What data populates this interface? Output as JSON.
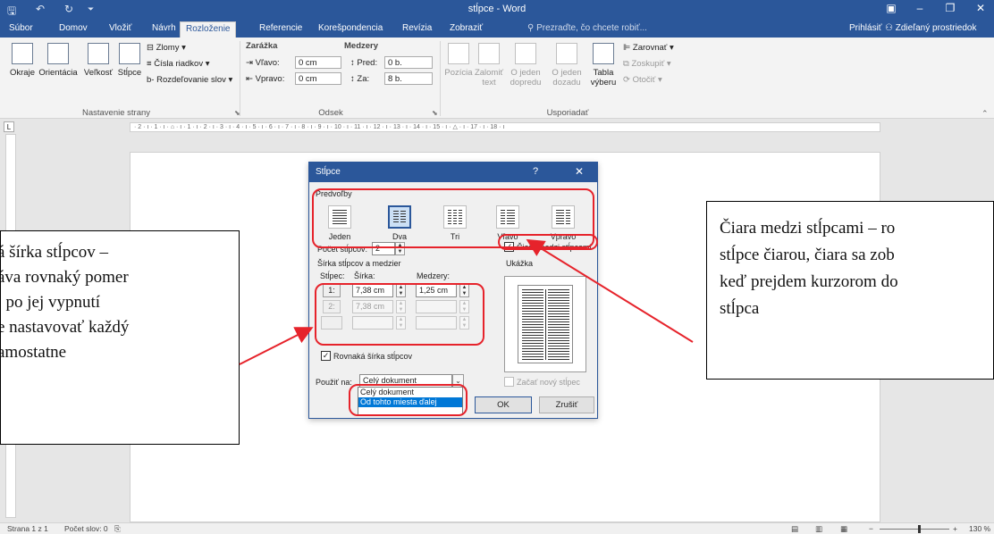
{
  "window": {
    "title": "stĺpce - Word",
    "quick_access": [
      "save-icon",
      "undo-icon",
      "redo-icon",
      "customize-icon"
    ],
    "controls": [
      "ribbon-display-icon",
      "minimize-icon",
      "restore-icon",
      "close-icon"
    ]
  },
  "tabs": [
    "Súbor",
    "Domov",
    "Vložiť",
    "Návrh",
    "Rozloženie",
    "Referencie",
    "Korešpondencia",
    "Revízia",
    "Zobraziť"
  ],
  "active_tab": "Rozloženie",
  "tell_me": "Prezraďte, čo chcete robiť...",
  "signin": "Prihlásiť",
  "share": "Zdieľaný prostriedok",
  "ribbon": {
    "page_setup": {
      "margins": "Okraje",
      "orientation": "Orientácia",
      "size": "Veľkosť",
      "columns": "Stĺpce",
      "breaks": "Zlomy",
      "line_numbers": "Čísla riadkov",
      "hyphenation": "Rozdeľovanie slov",
      "label": "Nastavenie strany"
    },
    "paragraph": {
      "indent_label": "Zarážka",
      "spacing_label": "Medzery",
      "left_label": "Vľavo:",
      "left_value": "0 cm",
      "right_label": "Vpravo:",
      "right_value": "0 cm",
      "before_label": "Pred:",
      "before_value": "0 b.",
      "after_label": "Za:",
      "after_value": "8 b.",
      "label": "Odsek"
    },
    "arrange": {
      "position": "Pozícia",
      "wrap_line1": "Zalomiť",
      "wrap_line2": "text",
      "forward_line1": "O jeden",
      "forward_line2": "dopredu",
      "backward_line1": "O jeden",
      "backward_line2": "dozadu",
      "selection_line1": "Tabla",
      "selection_line2": "výberu",
      "align": "Zarovnať",
      "group": "Zoskupiť",
      "rotate": "Otočiť",
      "label": "Usporiadať"
    }
  },
  "ruler_text": "· 2 · ı · 1 · ı · ⌂ · ı · 1 · ı · 2 · ı · 3 · ı · 4 · ı · 5 · ı · 6 · ı · 7 · ı · 8 · ı · 9 · ı · 10 · ı · 11 · ı · 12 · ı · 13 · ı · 14 · ı · 15 · ı · △ · ı · 17 · ı · 18 · ı",
  "ruler_corner": "L",
  "dialog": {
    "title": "Stĺpce",
    "help": "?",
    "close": "✕",
    "presets_label": "Predvoľby",
    "presets": [
      {
        "name": "Jeden",
        "cols": 1
      },
      {
        "name": "Dva",
        "cols": 2
      },
      {
        "name": "Tri",
        "cols": 3
      },
      {
        "name": "Vľavo",
        "cols": 2
      },
      {
        "name": "Vpravo",
        "cols": 2
      }
    ],
    "selected_preset": "Dva",
    "num_columns_label": "Počet stĺpcov:",
    "num_columns": "2",
    "line_between_label": "Čiara medzi stĺpcami",
    "line_between_checked": true,
    "width_spacing_label": "Šírka stĺpcov a medzier",
    "col_header": "Stĺpec:",
    "width_header": "Šírka:",
    "spacing_header": "Medzery:",
    "rows": [
      {
        "num": "1:",
        "width": "7,38 cm",
        "spacing": "1,25 cm"
      },
      {
        "num": "2:",
        "width": "7,38 cm",
        "spacing": ""
      }
    ],
    "preview_label": "Ukážka",
    "equal_width_label": "Rovnaká šírka stĺpcov",
    "equal_width_checked": true,
    "apply_to_label": "Použiť na:",
    "apply_to_value": "Celý dokument",
    "apply_to_options": [
      "Celý dokument",
      "Od tohto miesta ďalej"
    ],
    "highlighted_option": "Od tohto miesta ďalej",
    "new_column_label": "Začať nový stĺpec",
    "ok": "OK",
    "cancel": "Zrušiť"
  },
  "callouts": {
    "left": [
      "á šírka stĺpcov –",
      "áva rovnaký pomer",
      ", po jej vypnutí",
      "e nastavovať každý",
      "amostatne"
    ],
    "right": [
      "Čiara medzi stĺpcami – ro",
      "stĺpce čiarou, čiara sa zob",
      "keď prejdem kurzorom do",
      "stĺpca"
    ]
  },
  "statusbar": {
    "page": "Strana 1 z 1",
    "words": "Počet slov: 0",
    "zoom": "130 %"
  },
  "colors": {
    "brand": "#2b579a",
    "highlight": "#e6232b",
    "list_selection": "#0078d7"
  }
}
